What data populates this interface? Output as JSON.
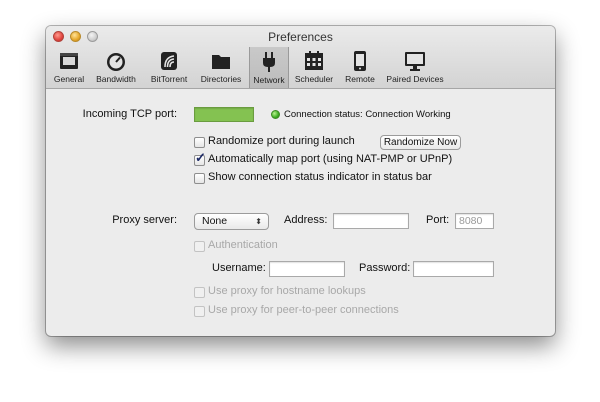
{
  "window": {
    "title": "Preferences"
  },
  "toolbar": {
    "tabs": [
      {
        "label": "General",
        "icon": "general-icon"
      },
      {
        "label": "Bandwidth",
        "icon": "bandwidth-gauge-icon"
      },
      {
        "label": "BitTorrent",
        "icon": "bittorrent-icon"
      },
      {
        "label": "Directories",
        "icon": "folder-icon"
      },
      {
        "label": "Network",
        "icon": "plug-icon",
        "selected": true
      },
      {
        "label": "Scheduler",
        "icon": "calendar-icon"
      },
      {
        "label": "Remote",
        "icon": "remote-device-icon"
      },
      {
        "label": "Paired Devices",
        "icon": "monitor-icon"
      }
    ]
  },
  "network": {
    "incoming_port_label": "Incoming TCP port:",
    "incoming_port_value": "",
    "connection_status": "Connection status: Connection Working",
    "status_color": "#3fae24",
    "randomize_port_label": "Randomize port during launch",
    "randomize_port_checked": false,
    "randomize_now_button": "Randomize Now",
    "auto_map_label": "Automatically map port (using NAT-PMP or UPnP)",
    "auto_map_checked": true,
    "show_indicator_label": "Show connection status indicator in status bar",
    "show_indicator_checked": false
  },
  "proxy": {
    "server_label": "Proxy server:",
    "server_value": "None",
    "address_label": "Address:",
    "address_value": "",
    "port_label": "Port:",
    "port_placeholder": "8080",
    "authentication_label": "Authentication",
    "username_label": "Username:",
    "username_value": "",
    "password_label": "Password:",
    "password_value": "",
    "hostname_lookups_label": "Use proxy for hostname lookups",
    "peer_connections_label": "Use proxy for peer-to-peer connections"
  }
}
